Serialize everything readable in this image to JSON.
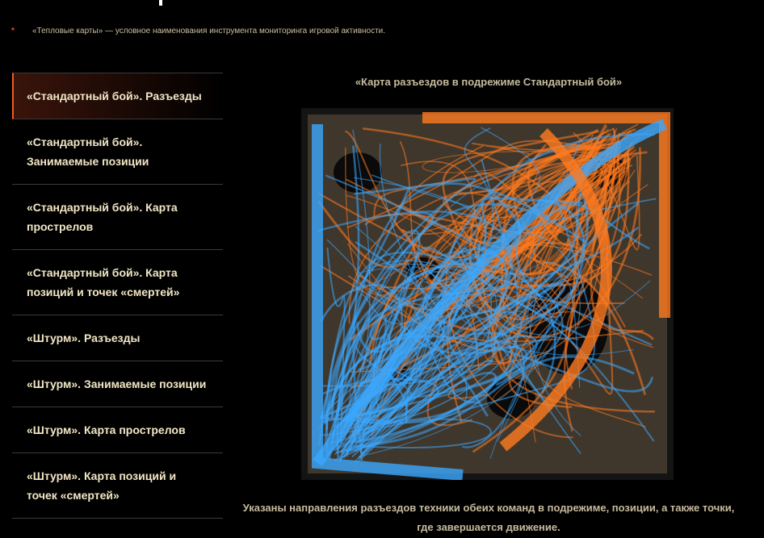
{
  "footnote": {
    "marker": "*",
    "text": "«Тепловые карты» — условное наименования инструмента мониторинга игровой активности."
  },
  "menu": [
    {
      "label": "«Стандартный бой». Разъезды",
      "active": true
    },
    {
      "label": "«Стандартный бой». Занимаемые позиции"
    },
    {
      "label": "«Стандартный бой». Карта прострелов"
    },
    {
      "label": "«Стандартный бой». Карта позиций и точек «смертей»"
    },
    {
      "label": "«Штурм». Разъезды"
    },
    {
      "label": "«Штурм». Занимаемые позиции"
    },
    {
      "label": "«Штурм». Карта прострелов"
    },
    {
      "label": "«Штурм». Карта позиций и точек «смертей»"
    }
  ],
  "content": {
    "caption": "«Карта разъездов в подрежиме Стандартный бой»",
    "description": "Указаны направления разъездов техники обеих команд в подрежиме, позиции, а также точки, где завершается движение."
  },
  "colors": {
    "accent": "#f05a22",
    "team_orange": "#ff7a1f",
    "team_blue": "#3aa8ff"
  }
}
